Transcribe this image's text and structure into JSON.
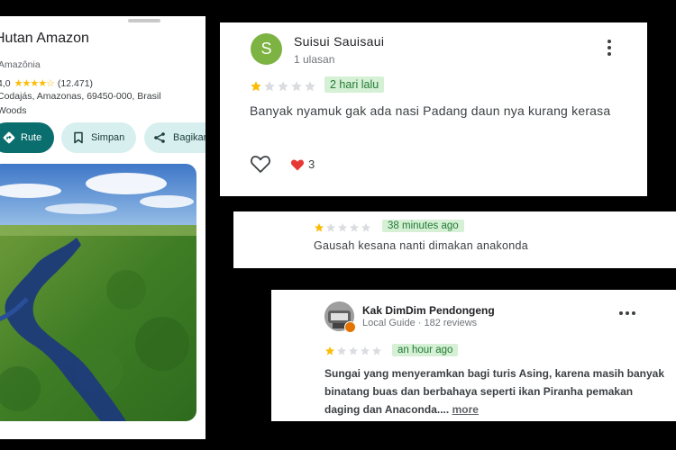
{
  "place": {
    "title": "Hutan Amazon",
    "subtitle": "Amazônia",
    "rating_value": "4,0",
    "rating_count": "(12.471)",
    "address_line1": "Codajás, Amazonas, 69450-000, Brasil",
    "address_line2": "Woods",
    "actions": {
      "route": "Rute",
      "save": "Simpan",
      "share": "Bagikan"
    }
  },
  "reviews": [
    {
      "avatar_letter": "S",
      "avatar_color": "#7cb342",
      "name": "Suisui Sauisaui",
      "meta": "1 ulasan",
      "stars": 1,
      "time": "2 hari lalu",
      "text": "Banyak nyamuk gak ada nasi Padang daun nya kurang kerasa",
      "likes": "3"
    },
    {
      "stars": 1,
      "time": "38 minutes ago",
      "text": "Gausah kesana nanti dimakan anakonda"
    },
    {
      "name": "Kak DimDim Pendongeng",
      "meta": "Local Guide · 182 reviews",
      "stars": 1,
      "time": "an hour ago",
      "text": "Sungai yang menyeramkan bagi turis Asing, karena masih banyak binatang buas dan berbahaya seperti ikan Piranha pemakan daging dan Anaconda....",
      "more": "more"
    }
  ],
  "colors": {
    "star_filled": "#fbbc04",
    "star_empty": "#dadce0",
    "badge_bg": "#d5f0d5",
    "badge_text": "#237a35",
    "route_button": "#0b6e6e",
    "chip_bg": "#d8efef",
    "heart": "#e53935"
  }
}
